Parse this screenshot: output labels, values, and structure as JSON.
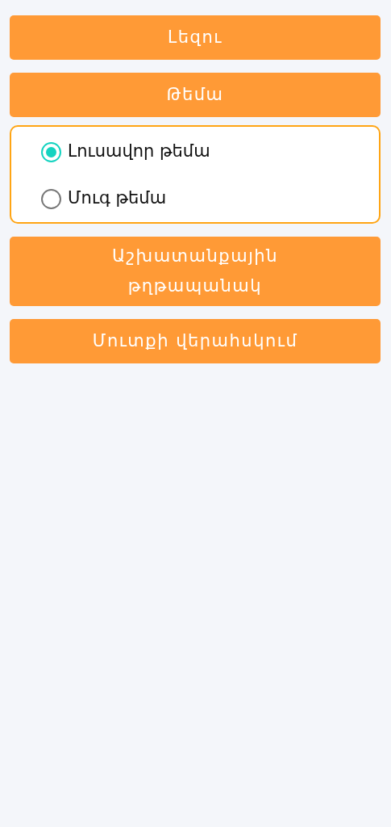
{
  "menu": [
    {
      "label": "Լեզու"
    },
    {
      "label": "Թեմա",
      "options": [
        {
          "label": "Լուսավոր թեմա",
          "selected": true
        },
        {
          "label": "Մուգ թեմա",
          "selected": false
        }
      ]
    },
    {
      "label": "Աշխատանքային թղթապանակ"
    },
    {
      "label": "Մուտքի վերահսկում"
    }
  ]
}
